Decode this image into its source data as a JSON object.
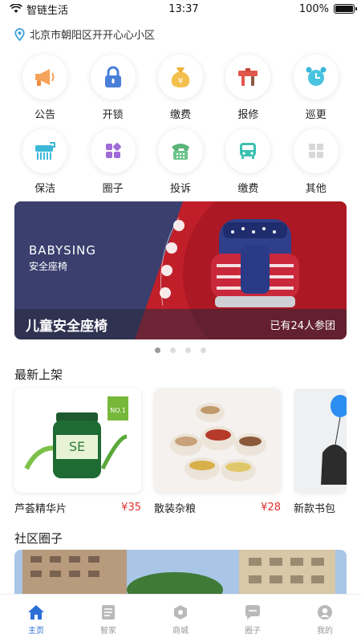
{
  "status": {
    "carrier": "智链生活",
    "time": "13:37",
    "battery": "100%"
  },
  "location": {
    "text": "北京市朝阳区开开心心小区"
  },
  "services_row1": [
    {
      "label": "公告",
      "icon": "megaphone-icon"
    },
    {
      "label": "开锁",
      "icon": "lock-icon"
    },
    {
      "label": "缴费",
      "icon": "money-bag-icon"
    },
    {
      "label": "报修",
      "icon": "toolbox-icon"
    },
    {
      "label": "巡更",
      "icon": "alarm-clock-icon"
    }
  ],
  "services_row2": [
    {
      "label": "保洁",
      "icon": "cleaning-icon"
    },
    {
      "label": "圈子",
      "icon": "circle-grid-icon"
    },
    {
      "label": "投诉",
      "icon": "phone-icon"
    },
    {
      "label": "缴费",
      "icon": "bus-card-icon"
    },
    {
      "label": "其他",
      "icon": "grid-icon"
    }
  ],
  "banner": {
    "brand": "BABYSING",
    "subtitle": "安全座椅",
    "title": "儿童安全座椅",
    "participants": "已有24人参团",
    "colors": {
      "left": "#3a3f6e",
      "right": "#c01f2a"
    }
  },
  "carousel": {
    "count": 4,
    "active": 0
  },
  "new_arrivals": {
    "title": "最新上架",
    "items": [
      {
        "name": "芦荟精华片",
        "price": "¥35"
      },
      {
        "name": "散装杂粮",
        "price": "¥28"
      },
      {
        "name": "新款书包",
        "price": ""
      }
    ]
  },
  "community": {
    "title": "社区圈子"
  },
  "tabbar": [
    {
      "label": "主页",
      "icon": "home-icon",
      "active": true
    },
    {
      "label": "智家",
      "icon": "list-icon",
      "active": false
    },
    {
      "label": "商城",
      "icon": "shop-icon",
      "active": false
    },
    {
      "label": "圈子",
      "icon": "chat-icon",
      "active": false
    },
    {
      "label": "我的",
      "icon": "profile-icon",
      "active": false
    }
  ],
  "colors": {
    "accent": "#2b6fd6",
    "price": "#e0312f"
  }
}
